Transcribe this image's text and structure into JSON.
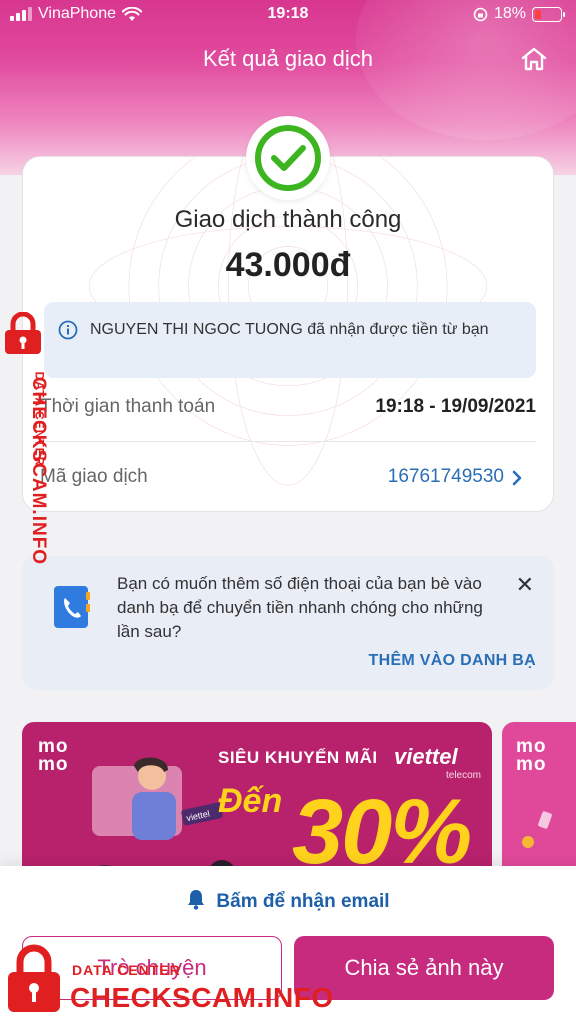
{
  "status_bar": {
    "carrier": "VinaPhone",
    "time": "19:18",
    "battery": "18%"
  },
  "header": {
    "title": "Kết quả giao dịch"
  },
  "result": {
    "status": "Giao dịch thành công",
    "amount": "43.000đ",
    "notice": "NGUYEN THI NGOC TUONG đã nhận được tiền từ bạn",
    "time_label": "Thời gian thanh toán",
    "time_value": "19:18 - 19/09/2021",
    "txid_label": "Mã giao dịch",
    "txid_value": "16761749530"
  },
  "suggestion": {
    "text": "Bạn có muốn thêm số điện thoại của bạn bè vào danh bạ để chuyển tiền nhanh chóng cho những lần sau?",
    "action": "THÊM VÀO DANH BẠ"
  },
  "promo": {
    "logo": "mo mo",
    "title": "SIÊU KHUYẾN MÃI",
    "brand": "viettel",
    "brand_sub": "telecom",
    "prefix": "Đến",
    "percent": "30%"
  },
  "bottom": {
    "email_link": "Bấm để nhận email",
    "chat_button": "Trò chuyện",
    "share_button": "Chia sẻ ảnh này"
  },
  "watermark": {
    "brand": "CHECKSCAM.INFO",
    "sub": "DATA CENTER"
  },
  "colors": {
    "brand_pink": "#c72b7e",
    "success_green": "#3cb521",
    "link_blue": "#2a6fb5",
    "watermark_red": "#e02020"
  }
}
